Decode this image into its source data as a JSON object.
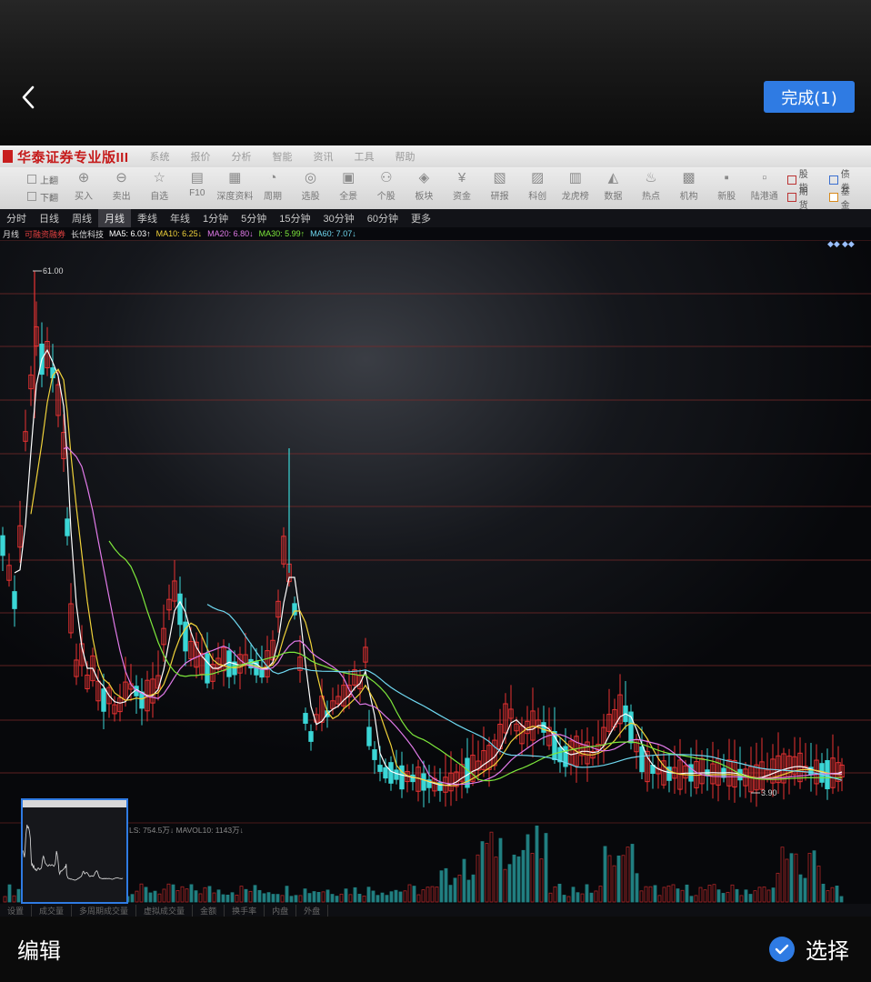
{
  "header": {
    "done_label": "完成(1)"
  },
  "screen": {
    "app_title": "华泰证券专业版III",
    "menu": [
      "系统",
      "报价",
      "分析",
      "智能",
      "资讯",
      "工具",
      "帮助"
    ],
    "nav": [
      "上翻",
      "下翻",
      "返回"
    ],
    "toolbar": [
      "买入",
      "卖出",
      "自选",
      "F10",
      "深度资料",
      "周期",
      "选股",
      "全景",
      "个股",
      "板块",
      "资金",
      "研报",
      "科创",
      "龙虎榜",
      "数据",
      "热点",
      "机构",
      "新股",
      "陆港通"
    ],
    "toolbar_right": [
      "股指",
      "债券",
      "期货",
      "基金"
    ],
    "periods": [
      "分时",
      "日线",
      "周线",
      "月线",
      "季线",
      "年线",
      "1分钟",
      "5分钟",
      "15分钟",
      "30分钟",
      "60分钟",
      "更多"
    ],
    "active_period": "月线",
    "ma_row": {
      "period": "月线",
      "tag": "可融资融券",
      "stock": "长信科技",
      "ma5": "MA5: 6.03↑",
      "ma10": "MA10: 6.25↓",
      "ma20": "MA20: 6.80↓",
      "ma30": "MA30: 5.99↑",
      "ma60": "MA60: 7.07↓"
    },
    "high_label": "61.00",
    "low_label": "3.90",
    "volume_label": "LS: 754.5万↓ MAVOL10: 1143万↓",
    "bottom_tabs": [
      "设置",
      "成交量",
      "多周期成交量",
      "虚拟成交量",
      "金额",
      "换手率",
      "内盘",
      "外盘"
    ],
    "colors": {
      "up": "#e83232",
      "down": "#3bd6d6",
      "ma5": "#ffffff",
      "ma10": "#f0d23a",
      "ma20": "#e07ae8",
      "ma30": "#7ee83c",
      "ma60": "#6fd8f0"
    }
  },
  "footer": {
    "edit_label": "编辑",
    "select_label": "选择"
  }
}
